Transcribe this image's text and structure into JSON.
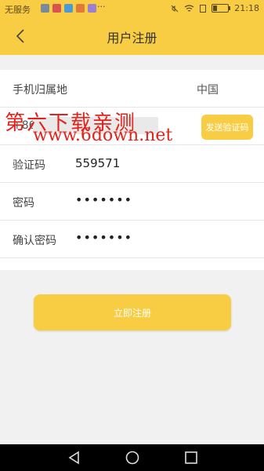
{
  "status_bar": {
    "carrier": "无服务",
    "more": "···",
    "time": "21:18"
  },
  "header": {
    "title": "用户注册"
  },
  "form": {
    "region_label": "手机归属地",
    "region_value": "中国",
    "phone_prefix": "+86",
    "send_code_label": "发送验证码",
    "code_label": "验证码",
    "code_value": "559571",
    "password_label": "密码",
    "password_masked": "•••••••",
    "confirm_label": "确认密码",
    "confirm_masked": "•••••••"
  },
  "register_button": "立即注册",
  "watermark": {
    "line1": "第六下载亲测",
    "line2": "www.6down.net"
  },
  "colors": {
    "accent": "#f8cd44",
    "watermark": "#e4221b"
  },
  "icons": [
    "wifi-icon",
    "battery-icon",
    "back-chevron-icon",
    "nav-back-icon",
    "nav-home-icon",
    "nav-recent-icon"
  ]
}
